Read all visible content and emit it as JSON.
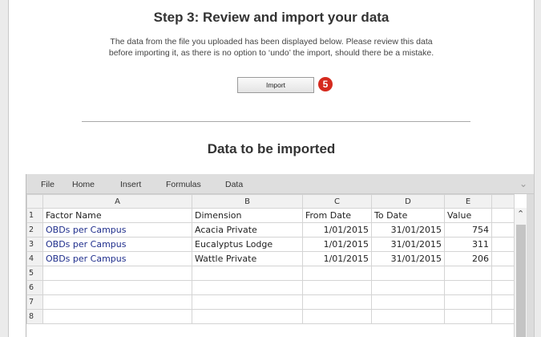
{
  "step_title": "Step 3: Review and import your data",
  "instructions": {
    "line1": "The data from the file you uploaded has been displayed below. Please review this data",
    "line2": "before importing it, as there is no option to ‘undo’ the import, should there be a mistake."
  },
  "import_button": "Import",
  "callout_number": "5",
  "section_title": "Data to be imported",
  "ribbon_tabs": [
    "File",
    "Home",
    "Insert",
    "Formulas",
    "Data"
  ],
  "column_headers": [
    "A",
    "B",
    "C",
    "D",
    "E",
    ""
  ],
  "rows": [
    {
      "num": "1",
      "cells": [
        "Factor Name",
        "Dimension",
        "From Date",
        "To Date",
        "Value",
        ""
      ]
    },
    {
      "num": "2",
      "cells": [
        "OBDs per Campus",
        "Acacia Private",
        "1/01/2015",
        "31/01/2015",
        "754",
        ""
      ]
    },
    {
      "num": "3",
      "cells": [
        "OBDs per Campus",
        "Eucalyptus Lodge",
        "1/01/2015",
        "31/01/2015",
        "311",
        ""
      ]
    },
    {
      "num": "4",
      "cells": [
        "OBDs per Campus",
        "Wattle Private",
        "1/01/2015",
        "31/01/2015",
        "206",
        ""
      ]
    },
    {
      "num": "5",
      "cells": [
        "",
        "",
        "",
        "",
        "",
        ""
      ]
    },
    {
      "num": "6",
      "cells": [
        "",
        "",
        "",
        "",
        "",
        ""
      ]
    },
    {
      "num": "7",
      "cells": [
        "",
        "",
        "",
        "",
        "",
        ""
      ]
    },
    {
      "num": "8",
      "cells": [
        "",
        "",
        "",
        "",
        "",
        ""
      ]
    }
  ],
  "colors": {
    "accent_red": "#d52a1e",
    "factor_text": "#1f2e8c"
  }
}
